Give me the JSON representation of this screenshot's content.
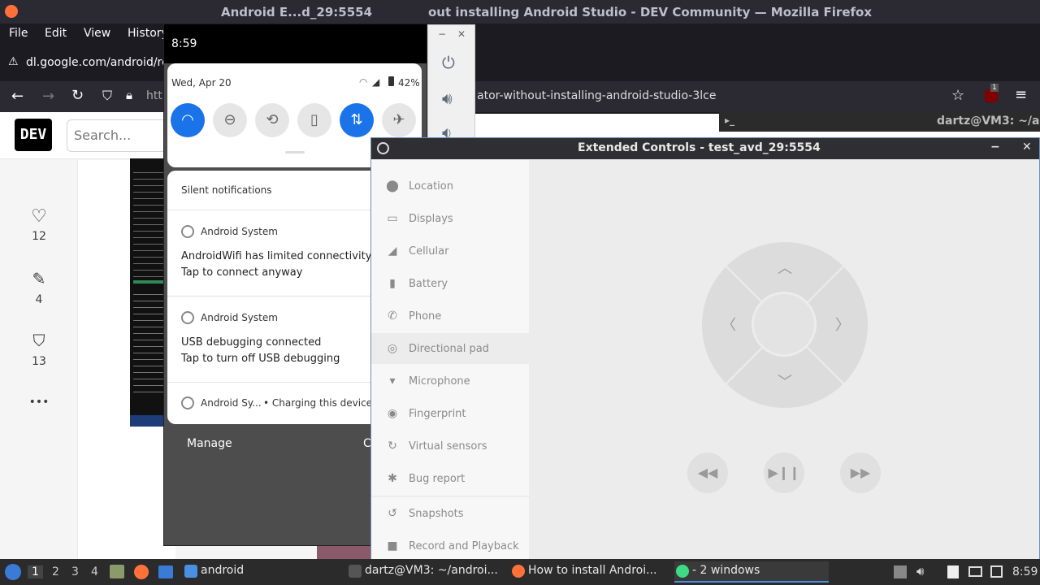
{
  "firefox": {
    "title_left": "Android E...d_29:5554",
    "title_right": "out installing Android Studio - DEV Community — Mozilla Firefox",
    "menu": [
      "File",
      "Edit",
      "View",
      "History"
    ],
    "download_url": "dl.google.com/android/re",
    "url_prefix": "htt",
    "url_suffix": "ator-without-installing-android-studio-3lce",
    "badge_count": "1"
  },
  "dev": {
    "logo": "DEV",
    "search_placeholder": "Search...",
    "reactions": [
      {
        "icon": "heart-icon",
        "count": "12"
      },
      {
        "icon": "unicorn-icon",
        "count": "4"
      },
      {
        "icon": "bookmark-icon",
        "count": "13"
      }
    ],
    "more": "•••"
  },
  "android": {
    "time": "8:59",
    "date": "Wed, Apr 20",
    "battery": "42%",
    "notif_header": "Silent notifications",
    "notifications": [
      {
        "app": "Android System",
        "line1": "AndroidWifi has limited connectivity",
        "line2": "Tap to connect anyway"
      },
      {
        "app": "Android System",
        "line1": "USB debugging connected",
        "line2": "Tap to turn off USB debugging"
      },
      {
        "app": "Android Sy...",
        "line1": "• Charging this device via"
      }
    ],
    "manage": "Manage",
    "clear": "C"
  },
  "terminal": {
    "title": "dartz@VM3: ~/a"
  },
  "extended_controls": {
    "title": "Extended Controls - test_avd_29:5554",
    "items": [
      {
        "label": "Location",
        "icon": "location-pin-icon"
      },
      {
        "label": "Displays",
        "icon": "display-icon"
      },
      {
        "label": "Cellular",
        "icon": "signal-icon"
      },
      {
        "label": "Battery",
        "icon": "battery-icon"
      },
      {
        "label": "Phone",
        "icon": "phone-icon"
      },
      {
        "label": "Directional pad",
        "icon": "dpad-icon"
      },
      {
        "label": "Microphone",
        "icon": "microphone-icon"
      },
      {
        "label": "Fingerprint",
        "icon": "fingerprint-icon"
      },
      {
        "label": "Virtual sensors",
        "icon": "sensors-icon"
      },
      {
        "label": "Bug report",
        "icon": "bug-icon"
      },
      {
        "label": "Snapshots",
        "icon": "history-icon"
      },
      {
        "label": "Record and Playback",
        "icon": "video-icon"
      }
    ],
    "active": "Directional pad"
  },
  "taskbar": {
    "workspaces": [
      "1",
      "2",
      "3",
      "4"
    ],
    "tasks": [
      {
        "label": "android",
        "icon": "folder-icon"
      },
      {
        "label": "dartz@VM3: ~/androi...",
        "icon": "terminal-icon"
      },
      {
        "label": "How to install Androi...",
        "icon": "firefox-icon"
      },
      {
        "label": "- 2 windows",
        "icon": "emulator-icon"
      }
    ],
    "clock": "8:59"
  }
}
